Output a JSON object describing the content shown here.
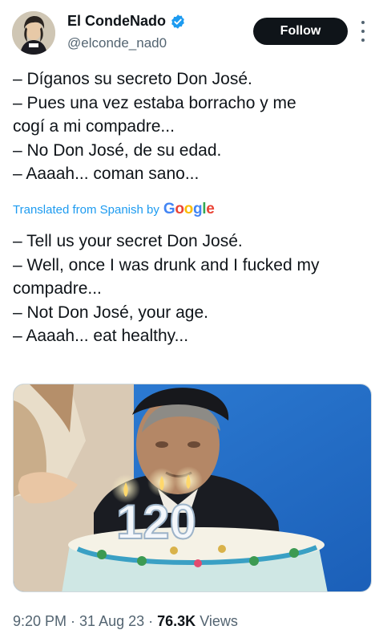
{
  "author": {
    "display_name": "El CondeNado",
    "handle": "@elconde_nad0",
    "verified_badge_color": "#1d9bf0",
    "avatar_icon": "avatar-portrait-icon"
  },
  "actions": {
    "follow_label": "Follow",
    "more_icon": "more-vertical-icon"
  },
  "tweet": {
    "lines": [
      "– Díganos su secreto Don José.",
      "– Pues una vez estaba borracho y me",
      "cogí a mi compadre...",
      "– No Don José, de su edad.",
      "– Aaaah... coman sano..."
    ]
  },
  "translation": {
    "label": "Translated from Spanish by",
    "provider": "Google",
    "lines": [
      "– Tell us your secret Don José.",
      "– Well, once I was drunk and I fucked my",
      "compadre...",
      "– Not Don José, your age.",
      "– Aaaah... eat healthy..."
    ]
  },
  "media": {
    "candle_number": "120"
  },
  "meta": {
    "time": "9:20 PM",
    "date": "31 Aug 23",
    "views_count": "76.3K",
    "views_label": "Views"
  },
  "colors": {
    "accent": "#1d9bf0",
    "text": "#0f1419",
    "secondary": "#536471"
  }
}
